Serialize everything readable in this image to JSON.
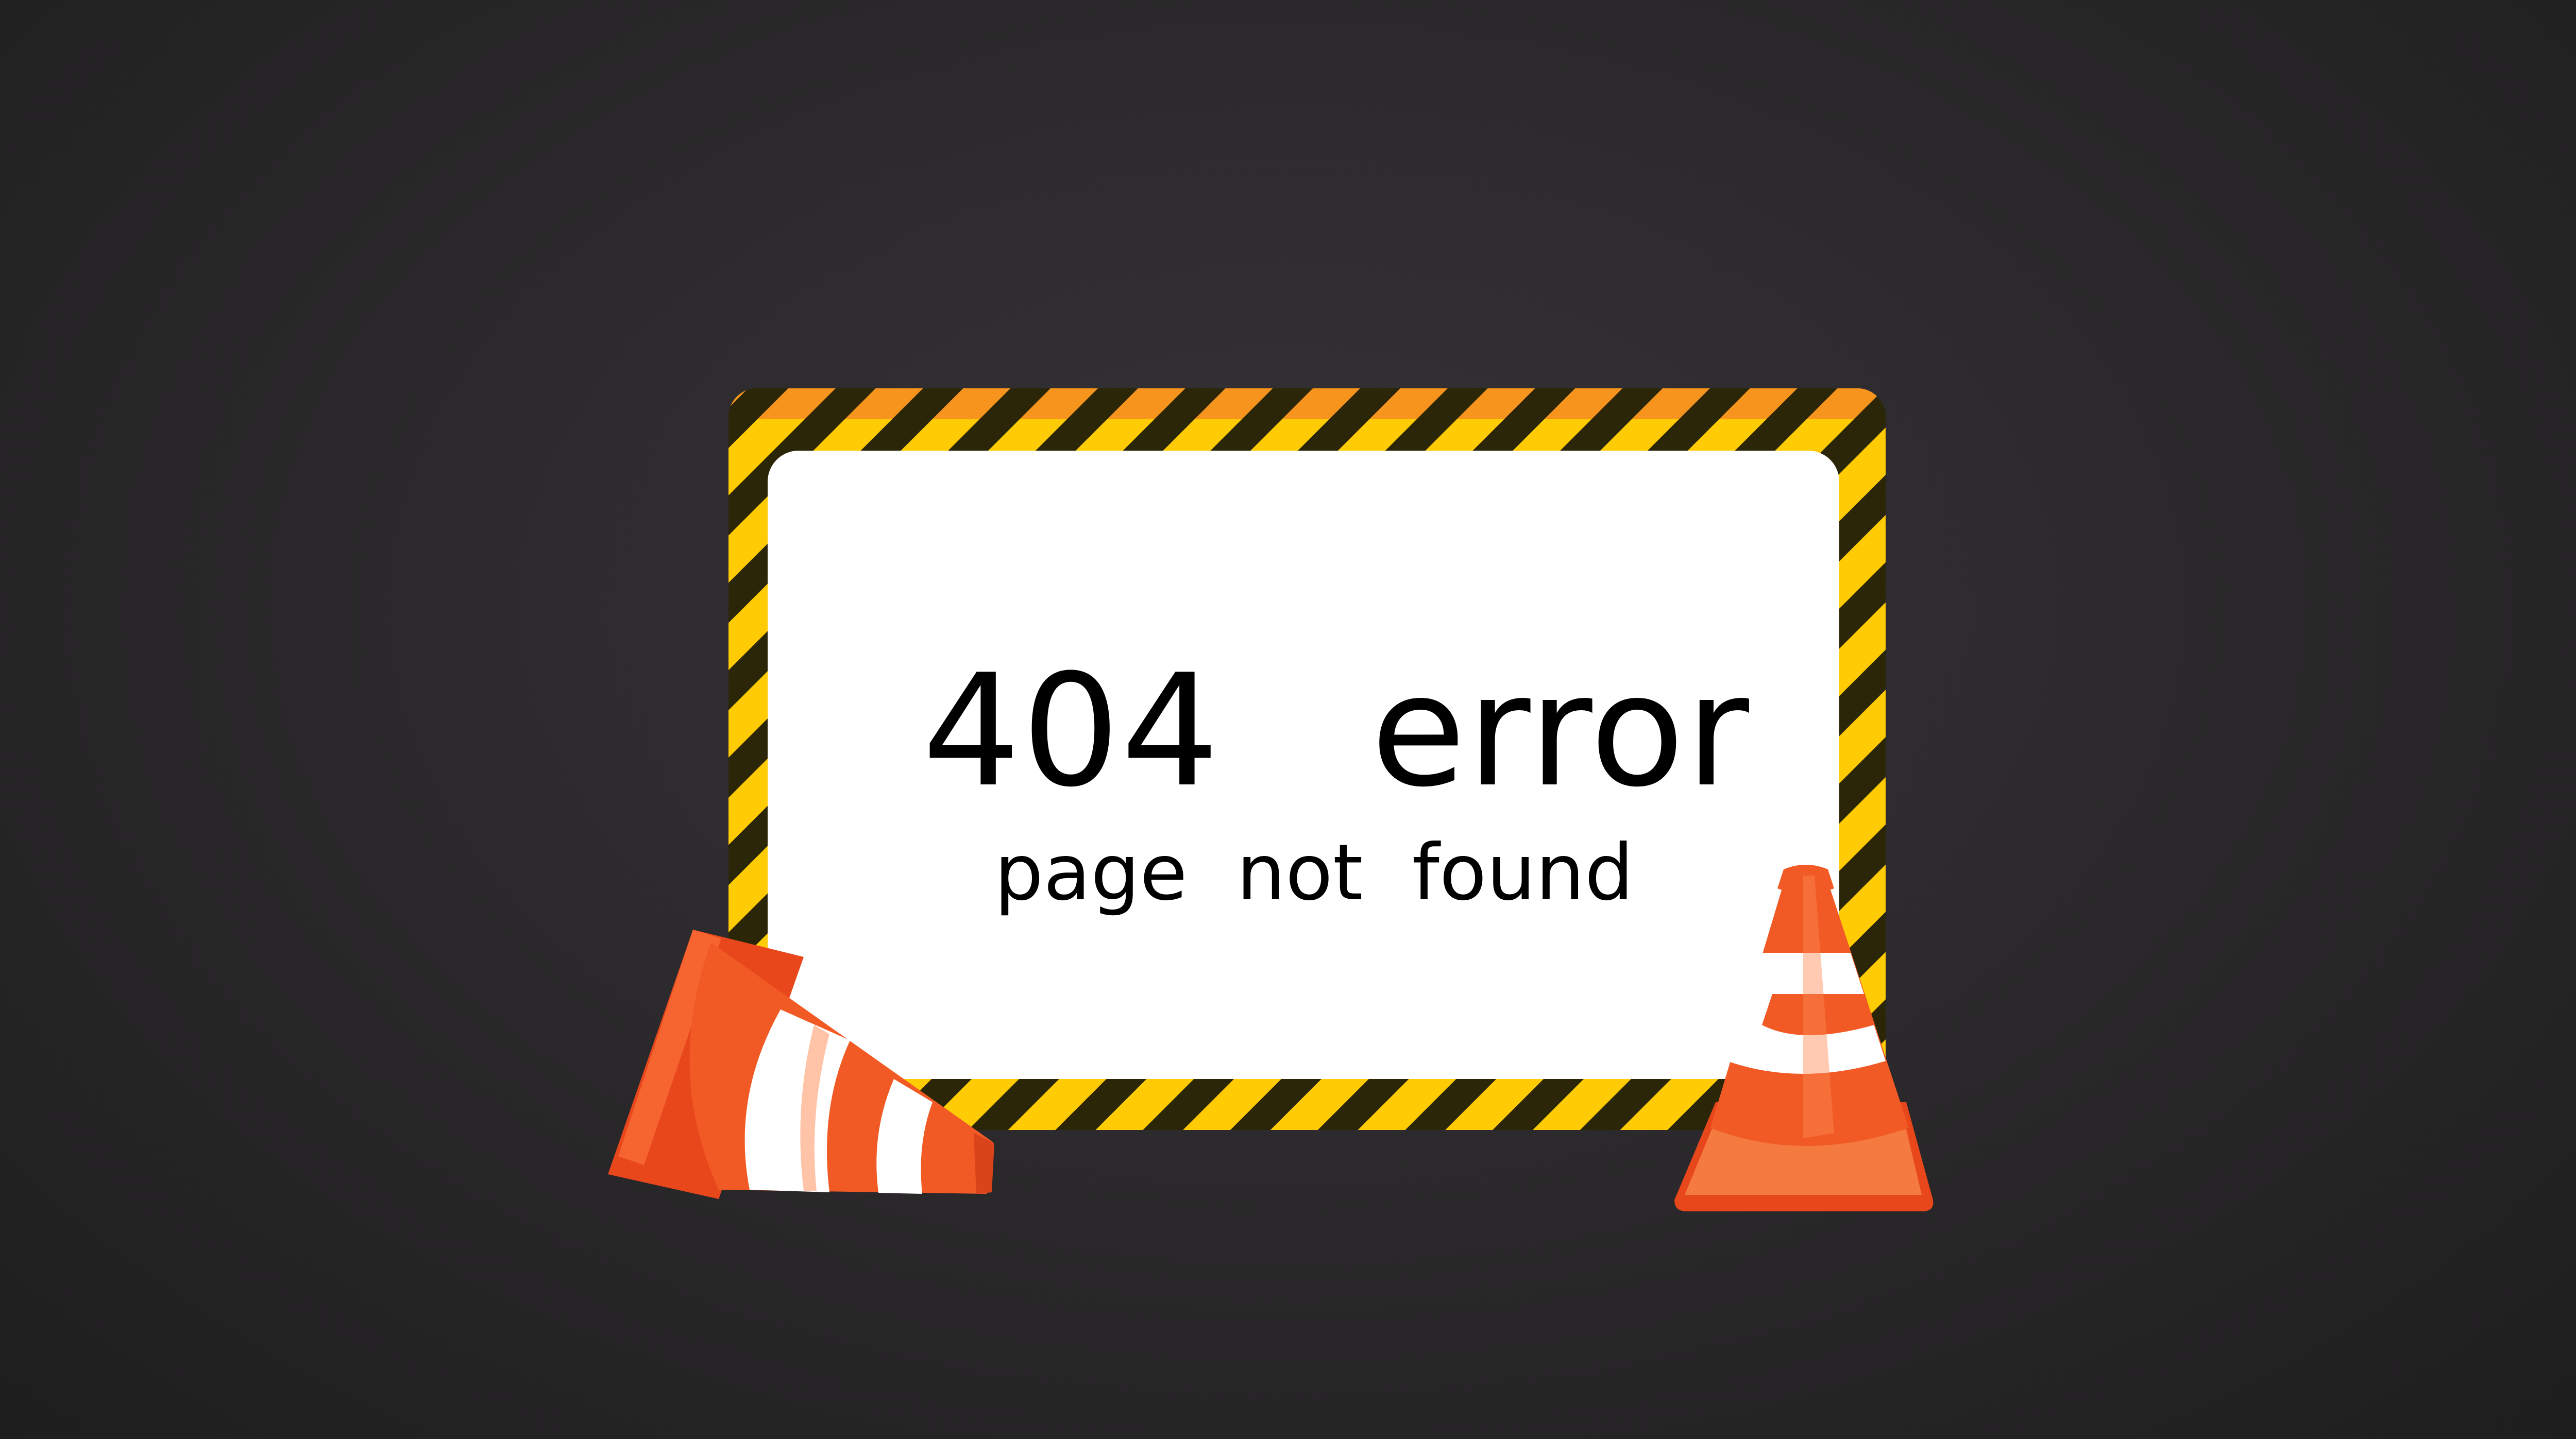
{
  "sign": {
    "headline": "404   error",
    "subline": "page  not  found"
  },
  "colors": {
    "background": "#2c2a2c",
    "hazard_yellow": "#ffcb05",
    "hazard_black": "#2b2608",
    "hazard_top_orange": "#f7941d",
    "panel_white": "#ffffff",
    "cone_orange": "#f15a24",
    "cone_base_red": "#e8471c",
    "cone_stripe_white": "#ffffff"
  },
  "icons": {
    "left": "fallen-traffic-cone-icon",
    "right": "standing-traffic-cone-icon"
  }
}
